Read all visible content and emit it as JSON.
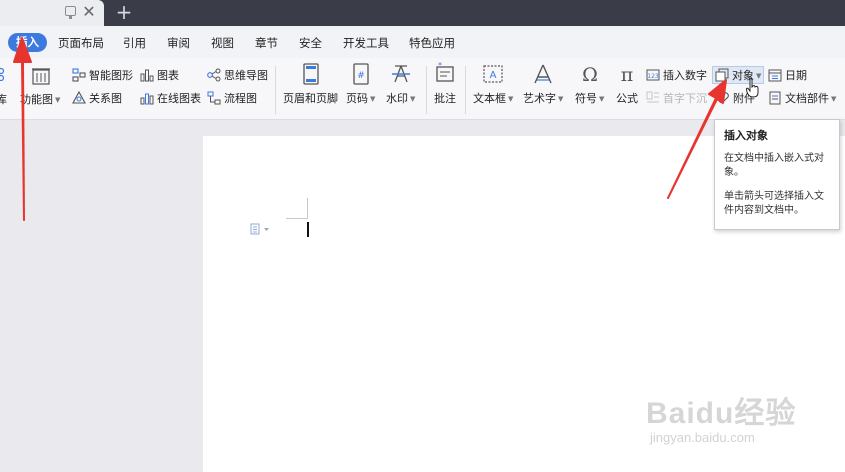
{
  "tabbar": {
    "new_tab": "+",
    "close": "✕"
  },
  "menu": {
    "items": [
      "插入",
      "页面布局",
      "引用",
      "审阅",
      "视图",
      "章节",
      "安全",
      "开发工具",
      "特色应用"
    ]
  },
  "ribbon": {
    "partial_left_top": "库",
    "partial_left_bottom": "功能图",
    "smartart": "智能图形",
    "chart": "图表",
    "mindmap": "思维导图",
    "relation": "关系图",
    "online_chart": "在线图表",
    "flowchart": "流程图",
    "header_footer": "页眉和页脚",
    "page_number": "页码",
    "watermark": "水印",
    "comment": "批注",
    "textbox": "文本框",
    "wordart": "艺术字",
    "symbol": "符号",
    "formula": "公式",
    "insert_number": "插入数字",
    "object": "对象",
    "date": "日期",
    "dropcap": "首字下沉",
    "attachment": "附件",
    "doc_parts": "文档部件"
  },
  "tooltip": {
    "title": "插入对象",
    "line1": "在文档中插入嵌入式对",
    "line2": "象。",
    "line3": "单击箭头可选择插入文",
    "line4": "件内容到文档中。"
  },
  "watermark_site": {
    "brand": "Baidu经验",
    "url": "jingyan.baidu.com"
  },
  "colors": {
    "accent": "#3c7ae0",
    "titlebar": "#3a3d47",
    "annotation_arrow": "#e8342f"
  }
}
